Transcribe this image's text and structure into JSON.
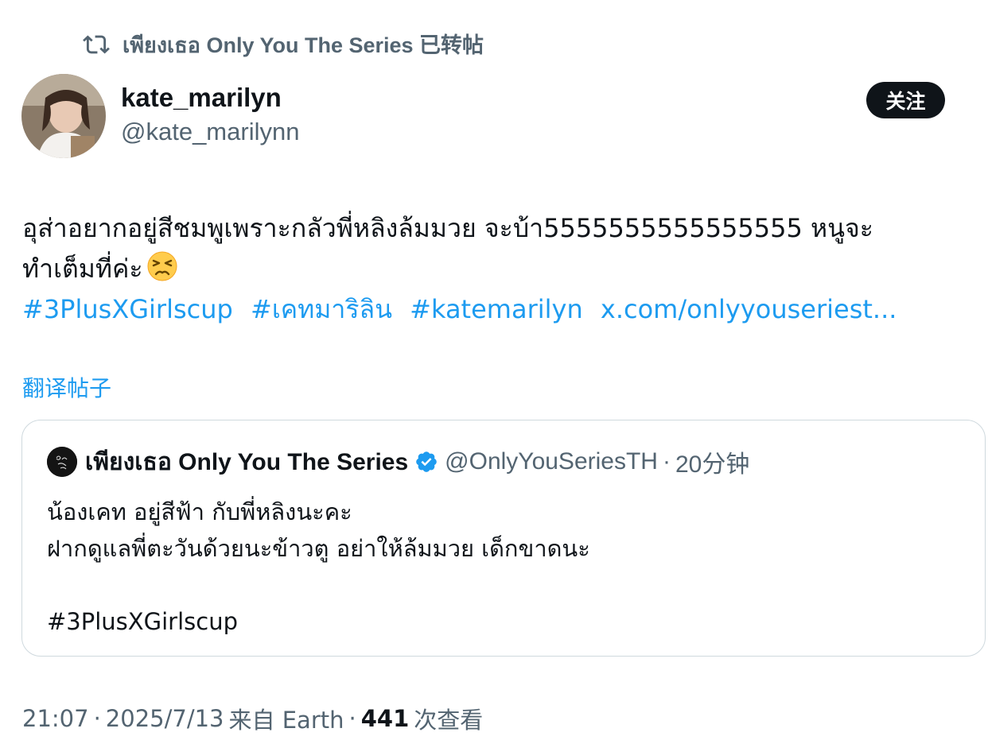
{
  "repost": {
    "icon": "repost-icon",
    "text": "เพียงเธอ Only You The Series 已转帖"
  },
  "author": {
    "display_name": "kate_marilyn",
    "handle": "@kate_marilynn",
    "avatar": "avatar"
  },
  "follow_button": {
    "label": "关注"
  },
  "tweet": {
    "line1": "อุส่าอยากอยู่สีชมพูเพราะกลัวพี่หลิงล้มมวย จะบ้า5555555555555555 หนูจะ",
    "line2": "ทำเต็มที่ค่ะ",
    "emoji": "persevering-face-emoji",
    "links": [
      "#3PlusXGirlscup",
      "#เคทมาริลิน",
      "#katemarilyn",
      "x.com/onlyyouseriest..."
    ]
  },
  "translate_label": "翻译帖子",
  "quote": {
    "name": "เพียงเธอ Only You The Series",
    "verified_icon": "verified-badge-icon",
    "handle": "@OnlyYouSeriesTH",
    "dot": "·",
    "time": "20分钟",
    "lines": [
      "น้องเคท อยู่สีฟ้า กับพี่หลิงนะคะ",
      "ฝากดูแลพี่ตะวันด้วยนะข้าวตู อย่าให้ล้มมวย เด็กขาดนะ",
      "",
      "#3PlusXGirlscup"
    ]
  },
  "meta": {
    "time": "21:07",
    "dot1": "·",
    "date": "2025/7/13",
    "source": "来自 Earth",
    "dot2": "·",
    "views_count": "441",
    "views_label": "次查看"
  },
  "colors": {
    "link": "#1d9bf0",
    "secondary_text": "#536471",
    "primary_text": "#0f1419",
    "border": "#cfd9de"
  }
}
